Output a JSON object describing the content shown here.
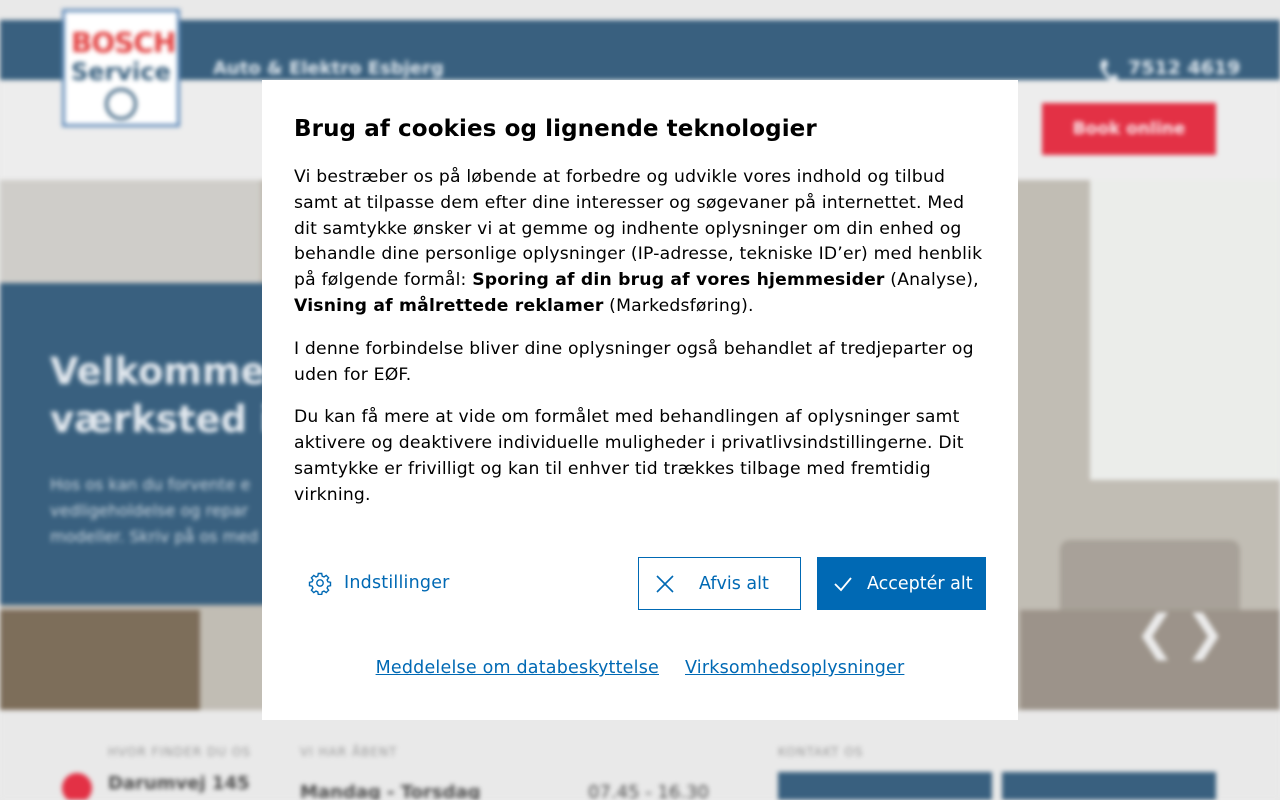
{
  "site": {
    "business_name": "Auto & Elektro Esbjerg",
    "phone": "7512 4619",
    "logo_brand": "BOSCH",
    "logo_sub": "Service",
    "book_button": "Book online",
    "hero_title_line1": "Velkommen t",
    "hero_title_line2": "værksted i E",
    "hero_text_line1": "Hos os kan du forvente e",
    "hero_text_line2": "vedligeholdelse og repar",
    "hero_text_line3": "modeller. Skriv på os med",
    "find_label": "HVOR FINDER DU OS",
    "address": "Darumvej 145",
    "hours_label": "VI HAR ÅBENT",
    "hours_day": "Mandag - Torsdag",
    "hours_time": "07.45 - 16.30",
    "contact_label": "KONTAKT OS",
    "prev_arrow": "❮",
    "next_arrow": "❯"
  },
  "dialog": {
    "title": "Brug af cookies og lignende teknologier",
    "p1_text": "Vi bestræber os på løbende at forbedre og udvikle vores indhold og tilbud samt at tilpasse dem efter dine interesser og søgevaner på internettet. Med dit samtykke ønsker vi at gemme og indhente oplysninger om din enhed og behandle dine personlige oplysninger (IP-adresse, tekniske ID’er) med henblik på følgende formål: ",
    "p1_bold1": "Sporing af din brug af vores hjemmesider",
    "p1_mid": " (Analyse), ",
    "p1_bold2": "Visning af målrettede reklamer",
    "p1_end": " (Markedsføring).",
    "p2": "I denne forbindelse bliver dine oplysninger også behandlet af tredjeparter og uden for EØF.",
    "p3": "Du kan få mere at vide om formålet med behandlingen af oplysninger samt aktivere og deaktivere individuelle muligheder i privatlivsindstillingerne. Dit samtykke er frivilligt og kan til enhver tid trækkes tilbage med fremtidig virkning.",
    "settings_label": "Indstillinger",
    "reject_label": "Afvis alt",
    "accept_label": "Acceptér alt",
    "privacy_link": "Meddelelse om databeskyttelse",
    "company_link": "Virksomhedsoplysninger",
    "accent_color": "#0069b4"
  }
}
